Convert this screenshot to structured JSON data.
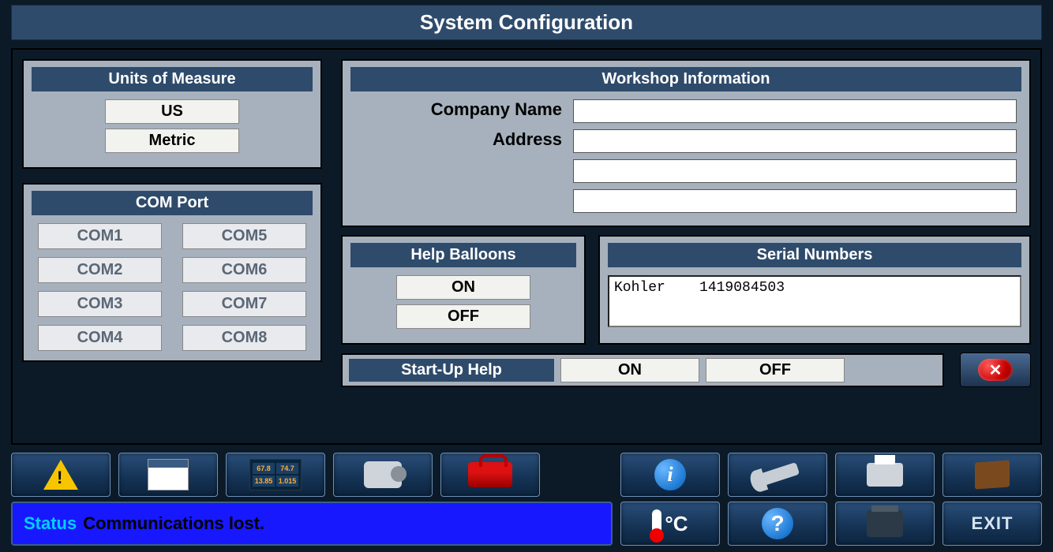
{
  "title": "System Configuration",
  "units": {
    "header": "Units of Measure",
    "us": "US",
    "metric": "Metric"
  },
  "comport": {
    "header": "COM Port",
    "ports": [
      "COM1",
      "COM2",
      "COM3",
      "COM4",
      "COM5",
      "COM6",
      "COM7",
      "COM8"
    ]
  },
  "workshop": {
    "header": "Workshop Information",
    "company_label": "Company Name",
    "address_label": "Address",
    "company_value": "",
    "address1": "",
    "address2": "",
    "address3": ""
  },
  "help_balloons": {
    "header": "Help Balloons",
    "on": "ON",
    "off": "OFF"
  },
  "serial": {
    "header": "Serial Numbers",
    "text": "Kohler    1419084503"
  },
  "startup": {
    "header": "Start-Up Help",
    "on": "ON",
    "off": "OFF"
  },
  "status": {
    "label": "Status",
    "message": "Communications lost."
  },
  "gauge": {
    "a": "67.8",
    "b": "74.7",
    "c": "13.85",
    "d": "1.015"
  },
  "thermo_unit": "°C",
  "exit_label": "EXIT"
}
